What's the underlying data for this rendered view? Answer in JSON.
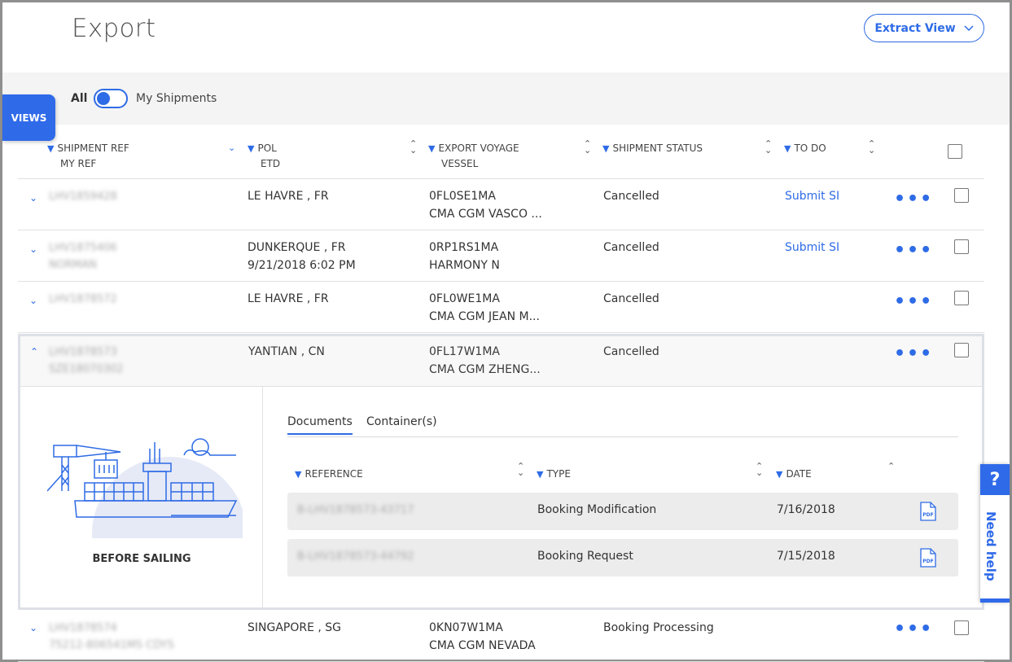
{
  "page": {
    "title": "Export"
  },
  "header": {
    "extract_label": "Extract View"
  },
  "toolbar": {
    "all_label": "All",
    "my_shipments_label": "My Shipments",
    "views_label": "VIEWS"
  },
  "columns": {
    "shipment_ref": "SHIPMENT REF",
    "my_ref": "MY REF",
    "pol": "POL",
    "etd": "ETD",
    "voyage": "EXPORT VOYAGE",
    "vessel": "VESSEL",
    "status": "SHIPMENT STATUS",
    "todo": "TO DO"
  },
  "rows": [
    {
      "ref": "LHV1859428",
      "myref": "",
      "pol": "LE HAVRE , FR",
      "etd": "",
      "voyage": "0FL0SE1MA",
      "vessel": "CMA CGM VASCO ...",
      "status": "Cancelled",
      "todo": "Submit SI"
    },
    {
      "ref": "LHV1875406",
      "myref": "NORMAN",
      "pol": "DUNKERQUE , FR",
      "etd": "9/21/2018 6:02 PM",
      "voyage": "0RP1RS1MA",
      "vessel": "HARMONY N",
      "status": "Cancelled",
      "todo": "Submit SI"
    },
    {
      "ref": "LHV1878572",
      "myref": "",
      "pol": "LE HAVRE , FR",
      "etd": "",
      "voyage": "0FL0WE1MA",
      "vessel": "CMA CGM JEAN M...",
      "status": "Cancelled",
      "todo": ""
    },
    {
      "ref": "LHV1878573",
      "myref": "SZE18070302",
      "pol": "YANTIAN , CN",
      "etd": "",
      "voyage": "0FL17W1MA",
      "vessel": "CMA CGM ZHENG...",
      "status": "Cancelled",
      "todo": ""
    },
    {
      "ref": "LHV1878574",
      "myref": "75212-806541MS CDYS",
      "pol": "SINGAPORE , SG",
      "etd": "",
      "voyage": "0KN07W1MA",
      "vessel": "CMA CGM NEVADA",
      "status": "Booking Processing",
      "todo": ""
    }
  ],
  "expanded": {
    "stage_label": "BEFORE SAILING",
    "tabs": [
      "Documents",
      "Container(s)"
    ],
    "doc_columns": {
      "reference": "REFERENCE",
      "type": "TYPE",
      "date": "DATE"
    },
    "documents": [
      {
        "reference": "B-LHV1878573-43717",
        "type": "Booking Modification",
        "date": "7/16/2018"
      },
      {
        "reference": "B-LHV1878573-44792",
        "type": "Booking Request",
        "date": "7/15/2018"
      }
    ]
  },
  "help": {
    "label": "Need help",
    "icon": "?"
  },
  "colors": {
    "accent": "#2e6be6",
    "tab_bg": "#2f6ae9"
  }
}
